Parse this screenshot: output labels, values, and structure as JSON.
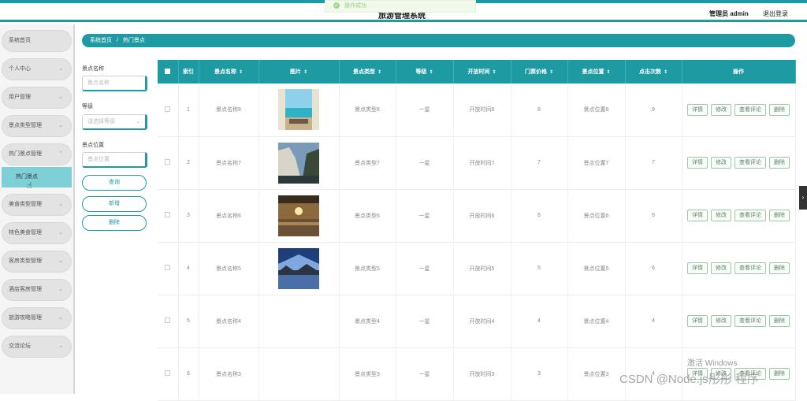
{
  "header": {
    "toast": "操作成功",
    "app_title": "旅游管理系统",
    "admin_label": "管理员 admin",
    "logout_label": "退出登录"
  },
  "sidebar": {
    "items": [
      {
        "label": "系统首页",
        "has_chevron": false
      },
      {
        "label": "个人中心",
        "has_chevron": true
      },
      {
        "label": "用户管理",
        "has_chevron": true
      },
      {
        "label": "景点类型管理",
        "has_chevron": true
      },
      {
        "label": "热门景点管理",
        "has_chevron": true,
        "expanded": true
      },
      {
        "label": "美食类型管理",
        "has_chevron": true
      },
      {
        "label": "特色美食管理",
        "has_chevron": true
      },
      {
        "label": "客房类型管理",
        "has_chevron": true
      },
      {
        "label": "酒店客房管理",
        "has_chevron": true
      },
      {
        "label": "旅游攻略管理",
        "has_chevron": true
      },
      {
        "label": "交流论坛",
        "has_chevron": true
      }
    ],
    "active_sub": "热门景点"
  },
  "breadcrumb": {
    "home": "系统首页",
    "separator": "/",
    "current": "热门景点"
  },
  "filters": {
    "name_label": "景点名称",
    "name_placeholder": "景点名称",
    "level_label": "等级",
    "level_placeholder": "请选择等级",
    "location_label": "景点位置",
    "location_placeholder": "景点位置",
    "search_btn": "查询",
    "add_btn": "新增",
    "delete_btn": "删除"
  },
  "table": {
    "headers": [
      "索引",
      "景点名称",
      "图片",
      "景点类型",
      "等级",
      "开放时间",
      "门票价格",
      "景点位置",
      "点击次数",
      "操作"
    ],
    "sortable": [
      false,
      true,
      true,
      true,
      true,
      true,
      true,
      true,
      true,
      false
    ],
    "rows": [
      {
        "index": "1",
        "name": "景点名称8",
        "image": "beach",
        "type": "景点类型8",
        "level": "一星",
        "open": "开放时间8",
        "price": "8",
        "location": "景点位置8",
        "clicks": "9"
      },
      {
        "index": "2",
        "name": "景点名称7",
        "image": "cliff",
        "type": "景点类型7",
        "level": "一星",
        "open": "开放时间7",
        "price": "7",
        "location": "景点位置7",
        "clicks": "7"
      },
      {
        "index": "3",
        "name": "景点名称6",
        "image": "sunset",
        "type": "景点类型6",
        "level": "一星",
        "open": "开放时间6",
        "price": "6",
        "location": "景点位置6",
        "clicks": "6"
      },
      {
        "index": "4",
        "name": "景点名称5",
        "image": "lake",
        "type": "景点类型5",
        "level": "一星",
        "open": "开放时间5",
        "price": "5",
        "location": "景点位置5",
        "clicks": "6"
      },
      {
        "index": "5",
        "name": "景点名称4",
        "image": "",
        "type": "景点类型4",
        "level": "一星",
        "open": "开放时间4",
        "price": "4",
        "location": "景点位置4",
        "clicks": "4"
      },
      {
        "index": "6",
        "name": "景点名称3",
        "image": "",
        "type": "景点类型3",
        "level": "一星",
        "open": "开放时间3",
        "price": "3",
        "location": "景点位置3",
        "clicks": "4"
      }
    ],
    "actions": [
      "详情",
      "修改",
      "查看评论",
      "删除"
    ]
  },
  "watermark": {
    "windows": "激活 Windows",
    "csdn": "CSDN @Node.js彤彤 程序"
  },
  "colors": {
    "accent": "#1e9aa3",
    "active_sub": "#7ecfd6",
    "button_border": "#9cc7a6"
  }
}
